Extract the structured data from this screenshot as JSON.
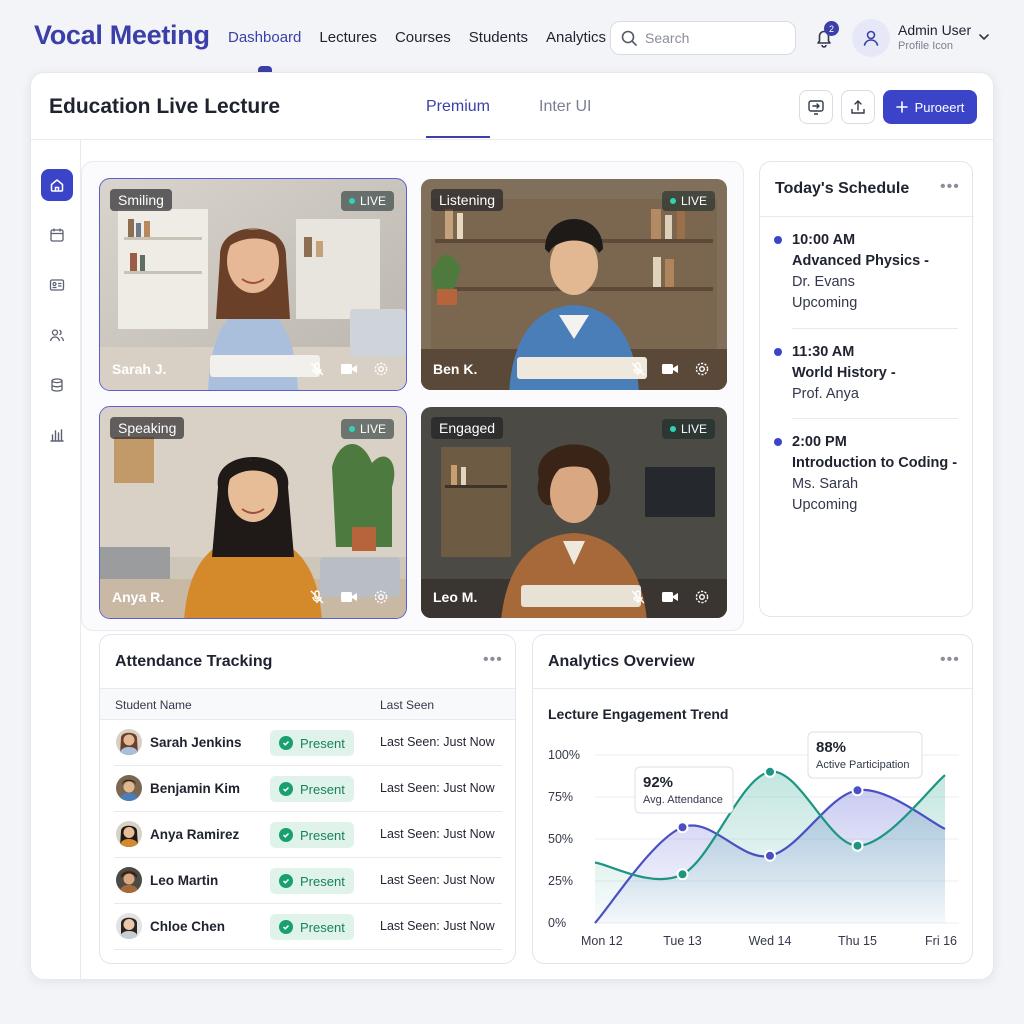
{
  "app": {
    "brand": "Vocal Meeting",
    "nav": [
      {
        "label": "Dashboard",
        "active": true
      },
      {
        "label": "Lectures"
      },
      {
        "label": "Courses"
      },
      {
        "label": "Students"
      },
      {
        "label": "Analytics"
      }
    ],
    "search_placeholder": "Search",
    "notifications_count": "2",
    "user": {
      "name": "Admin User",
      "subtitle": "Profile Icon"
    }
  },
  "header": {
    "title": "Education Live Lecture",
    "tabs": [
      {
        "label": "Premium",
        "active": true
      },
      {
        "label": "Inter UI"
      }
    ],
    "primary_button": "Puroeert"
  },
  "sidebar": {
    "items": [
      "home-icon",
      "calendar-icon",
      "id-card-icon",
      "users-icon",
      "database-icon",
      "bar-chart-icon"
    ]
  },
  "videos": [
    {
      "status": "Smiling",
      "live": "LIVE",
      "name": "Sarah J.",
      "highlighted": true
    },
    {
      "status": "Listening",
      "live": "LIVE",
      "name": "Ben K.",
      "highlighted": false
    },
    {
      "status": "Speaking",
      "live": "LIVE",
      "name": "Anya R.",
      "highlighted": true
    },
    {
      "status": "Engaged",
      "live": "LIVE",
      "name": "Leo M.",
      "highlighted": false
    }
  ],
  "schedule": {
    "title": "Today's Schedule",
    "items": [
      {
        "time": "10:00 AM",
        "course": "Advanced Physics -",
        "instructor": "Dr. Evans",
        "status": "Upcoming"
      },
      {
        "time": "11:30 AM",
        "course": "World History -",
        "instructor": "Prof. Anya",
        "status": ""
      },
      {
        "time": "2:00 PM",
        "course": "Introduction to Coding -",
        "instructor": "Ms. Sarah",
        "status": "Upcoming"
      }
    ]
  },
  "attendance": {
    "title": "Attendance Tracking",
    "columns": [
      "Student Name",
      "Last Seen"
    ],
    "rows": [
      {
        "name": "Sarah Jenkins",
        "status": "Present",
        "last_seen": "Last Seen: Just Now"
      },
      {
        "name": "Benjamin Kim",
        "status": "Present",
        "last_seen": "Last Seen: Just Now"
      },
      {
        "name": "Anya Ramirez",
        "status": "Present",
        "last_seen": "Last Seen: Just Now"
      },
      {
        "name": "Leo Martin",
        "status": "Present",
        "last_seen": "Last Seen: Just Now"
      },
      {
        "name": "Chloe Chen",
        "status": "Present",
        "last_seen": "Last Seen: Just Now"
      }
    ]
  },
  "analytics": {
    "title": "Analytics Overview"
  },
  "chart_data": {
    "type": "line",
    "title": "Lecture Engagement Trend",
    "categories": [
      "Mon 12",
      "Tue 13",
      "Wed 14",
      "Thu 15",
      "Fri 16"
    ],
    "ylim": [
      0,
      100
    ],
    "yticks": [
      "0%",
      "25%",
      "50%",
      "75%",
      "100%"
    ],
    "series": [
      {
        "name": "Avg. Attendance",
        "color": "#4a4fc4",
        "values": [
          0,
          57,
          40,
          79,
          56
        ]
      },
      {
        "name": "Active Participation",
        "color": "#1d9583",
        "values": [
          36,
          29,
          90,
          46,
          88
        ]
      }
    ],
    "annotations": [
      {
        "value": "92%",
        "label": "Avg. Attendance"
      },
      {
        "value": "88%",
        "label": "Active Participation"
      }
    ],
    "grid": true,
    "legend": "none"
  }
}
